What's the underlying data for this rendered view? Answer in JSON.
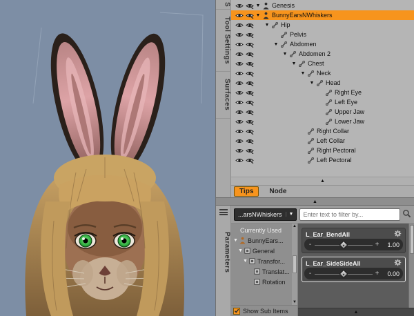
{
  "colors": {
    "accent_orange": "#f7941d",
    "viewport_bg": "#7d8ea5",
    "panel_gray": "#b5b5b5",
    "dark_panel": "#4c4c4c"
  },
  "scene_panel": {
    "side_tabs": [
      {
        "id": "scene",
        "label": "S"
      },
      {
        "id": "tool-settings",
        "label": "Tool Settings"
      },
      {
        "id": "surfaces",
        "label": "Surfaces"
      }
    ],
    "tree": [
      {
        "label": "Genesis",
        "indent": 0,
        "expander": "▼",
        "icon": "figure",
        "selected": false
      },
      {
        "label": "BunnyEarsNWhiskers",
        "indent": 0,
        "expander": "▼",
        "icon": "figure",
        "selected": true
      },
      {
        "label": "Hip",
        "indent": 1,
        "expander": "▼",
        "icon": "bone",
        "selected": false
      },
      {
        "label": "Pelvis",
        "indent": 2,
        "expander": "",
        "icon": "bone",
        "selected": false
      },
      {
        "label": "Abdomen",
        "indent": 2,
        "expander": "▼",
        "icon": "bone",
        "selected": false
      },
      {
        "label": "Abdomen 2",
        "indent": 3,
        "expander": "▼",
        "icon": "bone",
        "selected": false
      },
      {
        "label": "Chest",
        "indent": 4,
        "expander": "▼",
        "icon": "bone",
        "selected": false
      },
      {
        "label": "Neck",
        "indent": 5,
        "expander": "▼",
        "icon": "bone",
        "selected": false
      },
      {
        "label": "Head",
        "indent": 6,
        "expander": "▼",
        "icon": "bone",
        "selected": false
      },
      {
        "label": "Right Eye",
        "indent": 7,
        "expander": "",
        "icon": "bone",
        "selected": false
      },
      {
        "label": "Left Eye",
        "indent": 7,
        "expander": "",
        "icon": "bone",
        "selected": false
      },
      {
        "label": "Upper Jaw",
        "indent": 7,
        "expander": "",
        "icon": "bone",
        "selected": false
      },
      {
        "label": "Lower Jaw",
        "indent": 7,
        "expander": "",
        "icon": "bone",
        "selected": false
      },
      {
        "label": "Right Collar",
        "indent": 5,
        "expander": "",
        "icon": "bone",
        "selected": false
      },
      {
        "label": "Left Collar",
        "indent": 5,
        "expander": "",
        "icon": "bone",
        "selected": false
      },
      {
        "label": "Right Pectoral",
        "indent": 5,
        "expander": "",
        "icon": "bone",
        "selected": false
      },
      {
        "label": "Left Pectoral",
        "indent": 5,
        "expander": "",
        "icon": "bone",
        "selected": false
      }
    ],
    "scroll_up_arrow": "▲",
    "bottom_tabs": [
      {
        "label": "Tips",
        "active": true
      },
      {
        "label": "Node",
        "active": false
      }
    ]
  },
  "splitter": {
    "handle": "▲"
  },
  "parameters_panel": {
    "side_tab": "Parameters",
    "node_selector": {
      "label": "...arsNWhiskers",
      "arrow": "▼"
    },
    "filter": {
      "placeholder": "Enter text to filter by..."
    },
    "groups": [
      {
        "label": "Currently Used",
        "indent": 0,
        "arrow": "",
        "icon": "",
        "light": true
      },
      {
        "label": "BunnyEars...",
        "indent": 0,
        "arrow": "▼",
        "icon": "figure",
        "light": false
      },
      {
        "label": "General",
        "indent": 1,
        "arrow": "▼",
        "icon": "group",
        "light": false
      },
      {
        "label": "Transfor...",
        "indent": 2,
        "arrow": "▼",
        "icon": "group",
        "light": false
      },
      {
        "label": "Translat...",
        "indent": 3,
        "arrow": "",
        "icon": "group",
        "light": false
      },
      {
        "label": "Rotation",
        "indent": 3,
        "arrow": "",
        "icon": "group",
        "light": false
      }
    ],
    "groups_scroll_up": "▲",
    "groups_scroll_down": "▼",
    "show_sub_items": {
      "label": "Show Sub Items",
      "checked": true
    },
    "sliders": [
      {
        "name": "L_Ear_BendAll",
        "value": "1.00",
        "selected": false,
        "handle_pos": 0.5
      },
      {
        "name": "L_Ear_SideSideAll",
        "value": "0.00",
        "selected": true,
        "handle_pos": 0.5
      }
    ],
    "bottom_arrow": "▲"
  }
}
